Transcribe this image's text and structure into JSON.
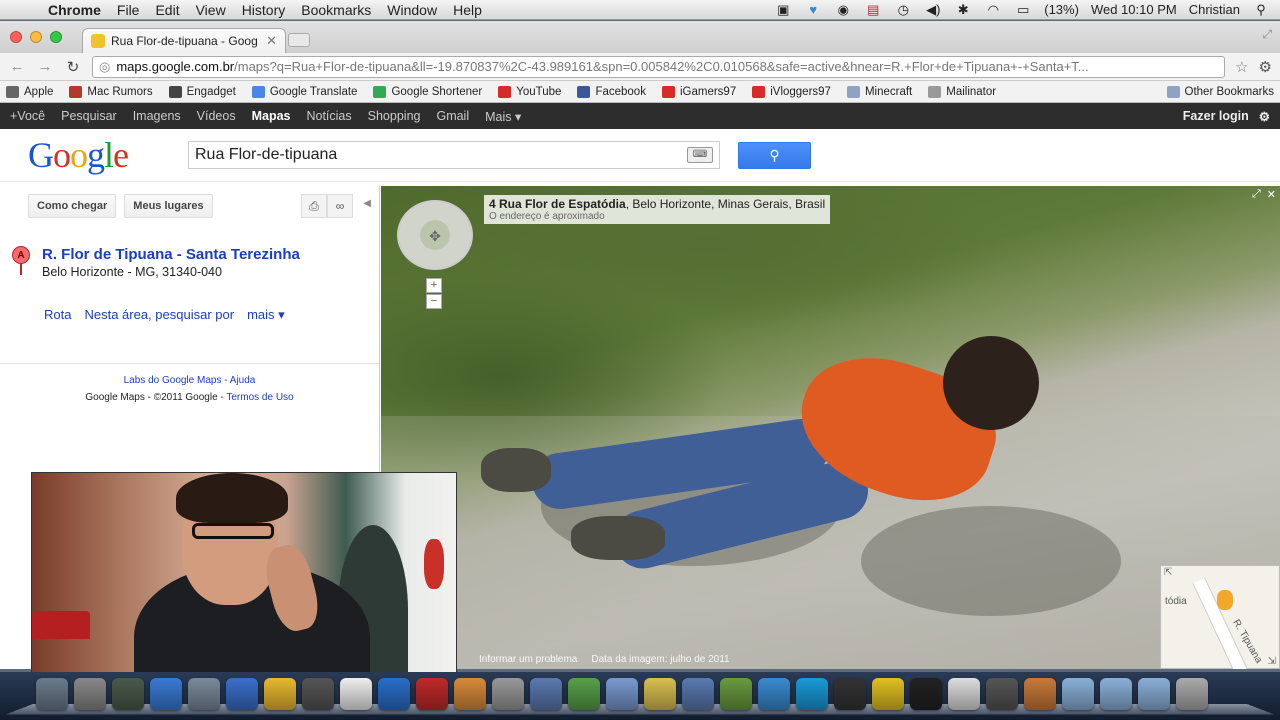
{
  "menubar": {
    "app_name": "Chrome",
    "items": [
      "File",
      "Edit",
      "View",
      "History",
      "Bookmarks",
      "Window",
      "Help"
    ],
    "battery": "(13%)",
    "clock": "Wed 10:10 PM",
    "user": "Christian"
  },
  "browser": {
    "tab_title": "Rua Flor-de-tipuana - Goog",
    "url_host": "maps.google.com.br",
    "url_path": "/maps?q=Rua+Flor-de-tipuana&ll=-19.870837%2C-43.989161&spn=0.005842%2C0.010568&safe=active&hnear=R.+Flor+de+Tipuana+-+Santa+T...",
    "bookmarks": [
      {
        "label": "Apple",
        "color": "#666666"
      },
      {
        "label": "Mac Rumors",
        "color": "#b33a2a"
      },
      {
        "label": "Engadget",
        "color": "#444444"
      },
      {
        "label": "Google Translate",
        "color": "#4a86e8"
      },
      {
        "label": "Google Shortener",
        "color": "#34a853"
      },
      {
        "label": "YouTube",
        "color": "#d92a2a"
      },
      {
        "label": "Facebook",
        "color": "#3b5998"
      },
      {
        "label": "iGamers97",
        "color": "#d92a2a"
      },
      {
        "label": "iVloggers97",
        "color": "#d92a2a"
      },
      {
        "label": "Minecraft",
        "color": "#8da3c4"
      },
      {
        "label": "Mailinator",
        "color": "#999999"
      }
    ],
    "other_bookmarks": "Other Bookmarks"
  },
  "gbar": {
    "items": [
      "+Você",
      "Pesquisar",
      "Imagens",
      "Vídeos",
      "Mapas",
      "Notícias",
      "Shopping",
      "Gmail",
      "Mais ▾"
    ],
    "selected": "Mapas",
    "login": "Fazer login"
  },
  "search": {
    "logo": [
      "G",
      "o",
      "o",
      "g",
      "l",
      "e"
    ],
    "query": "Rua Flor-de-tipuana"
  },
  "panel": {
    "btn_directions": "Como chegar",
    "btn_places": "Meus lugares",
    "pin_letter": "A",
    "result_title": "R. Flor de Tipuana - Santa Terezinha",
    "result_address": "Belo Horizonte - MG, 31340-040",
    "actions": [
      "Rota",
      "Nesta área, pesquisar por",
      "mais ▾"
    ],
    "footer_links": "Labs do Google Maps - Ajuda",
    "copyright": "Google Maps - ©2011 Google - ",
    "terms": "Termos de Uso"
  },
  "streetview": {
    "address_bold": "4 Rua Flor de Espatódia",
    "address_rest": ", Belo Horizonte, Minas Gerais, Brasil",
    "address_note": "O endereço é aproximado",
    "report": "Informar um problema",
    "image_date": "Data da imagem: julho de 2011",
    "minimap_label1": "tódia",
    "minimap_label2": "R. Tipuana"
  },
  "dock": {
    "icon_colors": [
      "#6b7b8c",
      "#888888",
      "#4a5a4a",
      "#3a7bd5",
      "#7a8a9a",
      "#3b6fc9",
      "#e8b830",
      "#555555",
      "#eeeeee",
      "#2a6fc9",
      "#c02a2a",
      "#d88a3a",
      "#999999",
      "#5a7ab0",
      "#58a04a",
      "#7a9ad0",
      "#d8c050",
      "#5a7ab0",
      "#6a9a40",
      "#3a8ad0",
      "#1a9ad8",
      "#333333",
      "#e0c020",
      "#222222",
      "#dddddd",
      "#555555",
      "#c87a3a",
      "#8ab0d8",
      "#8ab0d8",
      "#8ab0d8",
      "#aaaaaa"
    ]
  }
}
